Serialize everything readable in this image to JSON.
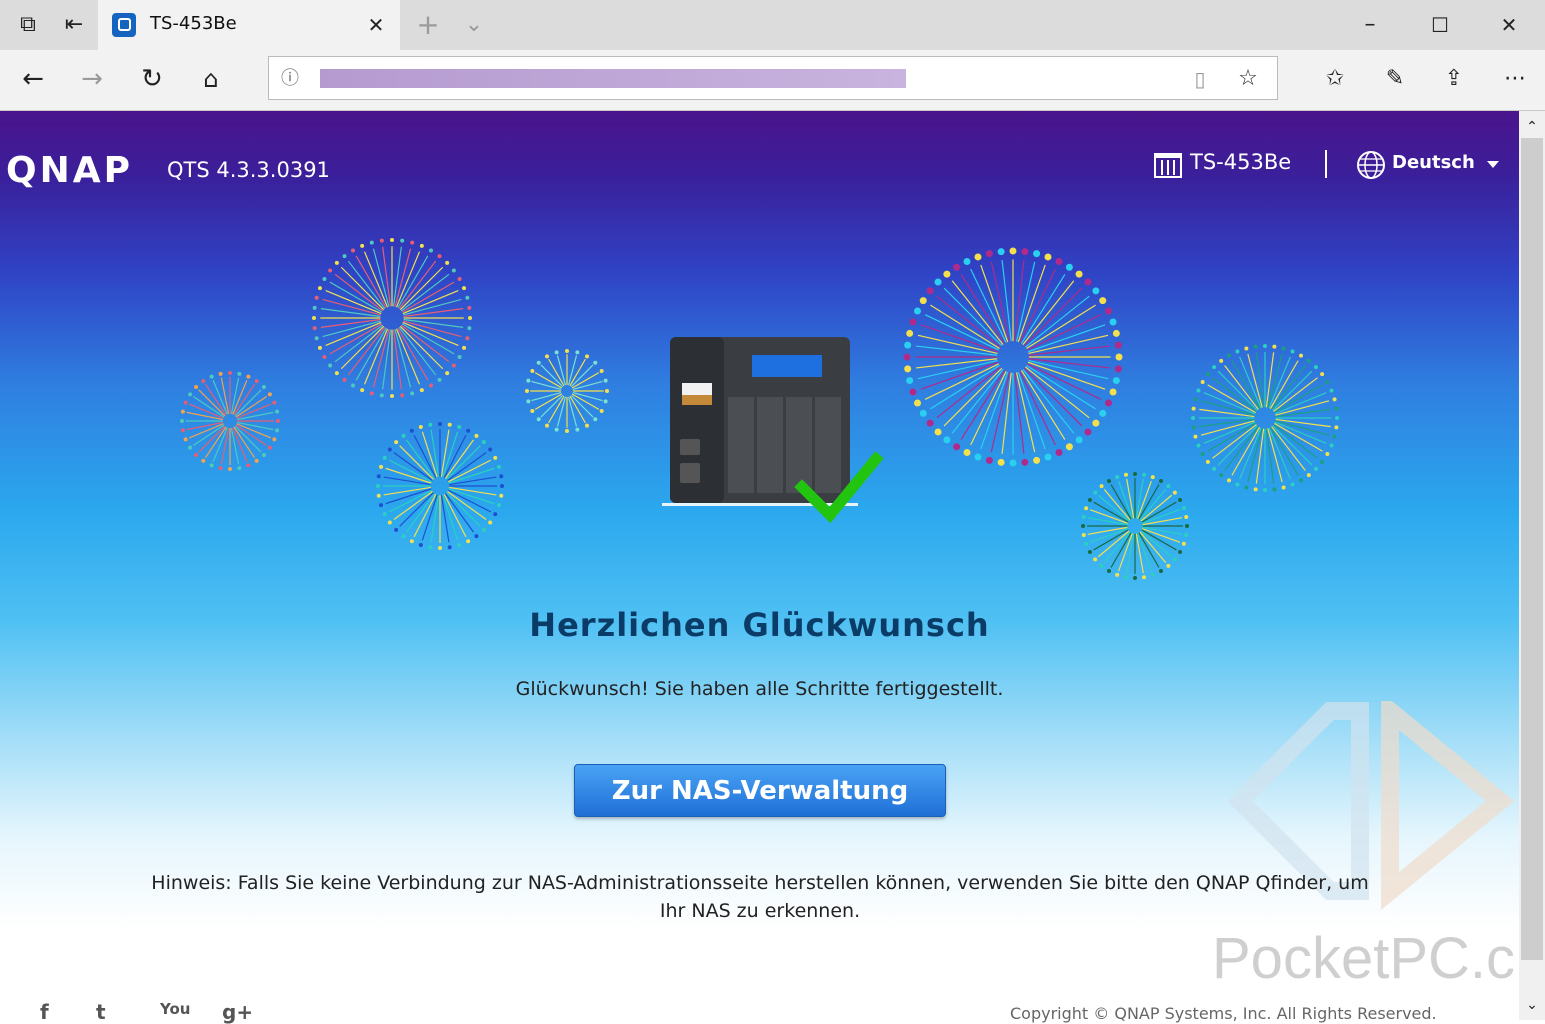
{
  "browser": {
    "tab_title": "TS-453Be",
    "address_text": ""
  },
  "header": {
    "logo": "QNAP",
    "version": "QTS 4.3.3.0391",
    "model": "TS-453Be",
    "language": "Deutsch"
  },
  "main": {
    "title": "Herzlichen Glückwunsch",
    "subtitle": "Glückwunsch! Sie haben alle Schritte fertiggestellt.",
    "button": "Zur NAS-Verwaltung",
    "hint": "Hinweis: Falls Sie keine Verbindung zur NAS-Administrationsseite herstellen können, verwenden Sie bitte den QNAP Qfinder, um Ihr NAS zu erkennen."
  },
  "footer": {
    "copyright": "Copyright © QNAP Systems, Inc. All Rights Reserved.",
    "social": [
      "f",
      "t",
      "You",
      "g+"
    ]
  },
  "watermark": "PocketPC.ch",
  "colors": {
    "heading": "#0a3c67",
    "button": "#2a83e8",
    "check": "#22c40f"
  }
}
